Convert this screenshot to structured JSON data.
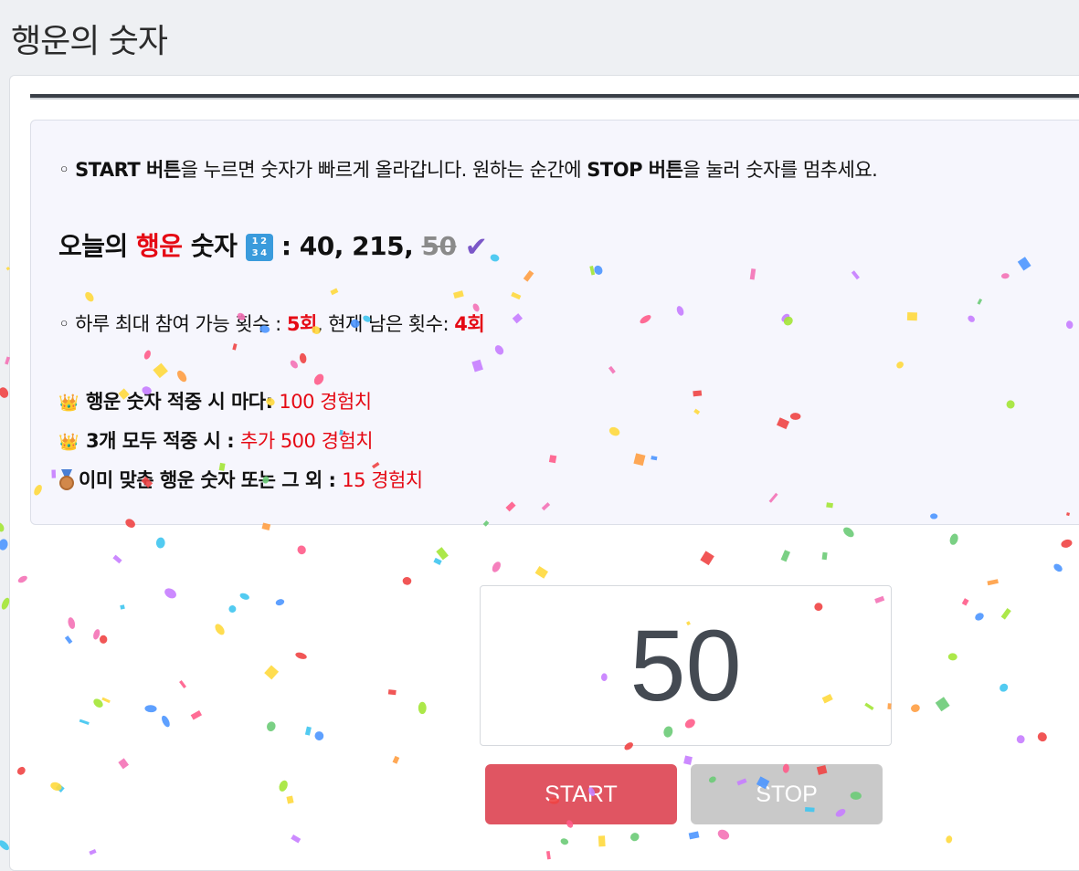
{
  "page": {
    "title": "행운의 숫자"
  },
  "info": {
    "intro": {
      "p1": "START 버튼",
      "p2": "을 누르면 숫자가 빠르게 올라갑니다. 원하는 순간에 ",
      "p3": "STOP 버튼",
      "p4": "을 눌러 숫자를 멈추세요."
    },
    "lucky": {
      "label_a": "오늘의 ",
      "label_red": "행운",
      "label_b": " 숫자",
      "icon_text": "1 2\n3 4",
      "separator": " : ",
      "numbers": "40, 215, ",
      "struck_number": "50",
      "check_icon": "check-icon"
    },
    "limit": {
      "prefix": "하루 최대 참여 가능 횟수 : ",
      "max": "5회",
      "middle": ", 현재 남은 횟수: ",
      "remaining": "4회"
    },
    "rewards": [
      {
        "icon": "crown-icon",
        "label": "행운 숫자 적중 시 마다: ",
        "value": "100 경험치"
      },
      {
        "icon": "crown-icon",
        "label": "3개 모두 적중 시 : ",
        "value": "추가 500 경험치"
      },
      {
        "icon": "medal-icon",
        "label": "이미 맞춘 행운 숫자 또는 그 외 : ",
        "value": "15 경험치"
      }
    ]
  },
  "game": {
    "current_number": "50",
    "start_label": "START",
    "stop_label": "STOP"
  },
  "colors": {
    "accent_red": "#e50914",
    "start_button": "#e05562",
    "stop_button_disabled": "#c9c9c9",
    "check": "#7b57c8"
  }
}
